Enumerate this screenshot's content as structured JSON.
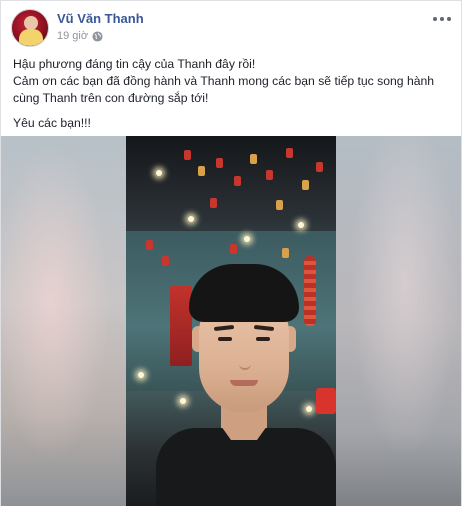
{
  "post": {
    "author": "Vũ Văn Thanh",
    "time": "19 giờ",
    "privacy_icon": "globe-icon",
    "menu_icon": "more-options-icon",
    "text_lines": [
      "Hậu phương đáng tin cậy của Thanh đây rồi!",
      "Cảm ơn các bạn đã đồng hành và Thanh mong các bạn sẽ tiếp tục song hành",
      "cùng Thanh trên con đường sắp tới!"
    ],
    "closing": "Yêu các bạn!!!"
  },
  "colors": {
    "author_link": "#385898",
    "meta_gray": "#90949c",
    "text": "#1d2129"
  }
}
